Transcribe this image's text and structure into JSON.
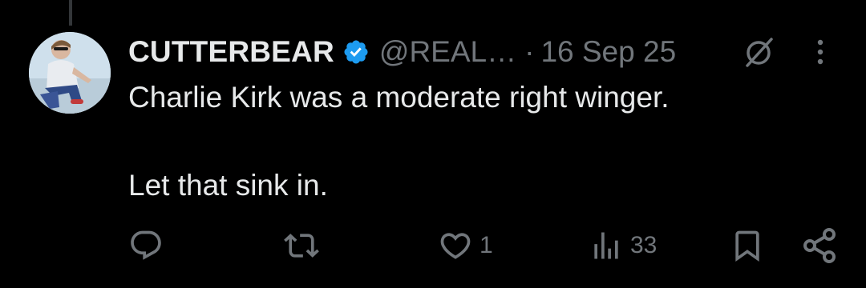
{
  "tweet": {
    "author": {
      "display_name": "CUTTERBEAR",
      "handle": "@REAL…",
      "verified": true,
      "avatar_icon": "user-photo"
    },
    "separator": "·",
    "date": "16 Sep 25",
    "text_lines": [
      "Charlie Kirk was a moderate right winger.",
      "Let that sink in."
    ],
    "actions": {
      "reply": {
        "icon": "reply-icon",
        "count": ""
      },
      "repost": {
        "icon": "repost-icon",
        "count": ""
      },
      "like": {
        "icon": "heart-icon",
        "count": "1"
      },
      "views": {
        "icon": "views-icon",
        "count": "33"
      },
      "bookmark": {
        "icon": "bookmark-icon"
      },
      "share": {
        "icon": "share-icon"
      }
    }
  },
  "colors": {
    "background": "#000000",
    "primary_text": "#e7e9ea",
    "secondary_text": "#71767b",
    "verified_blue": "#1d9bf0",
    "thread_line": "#333639"
  }
}
